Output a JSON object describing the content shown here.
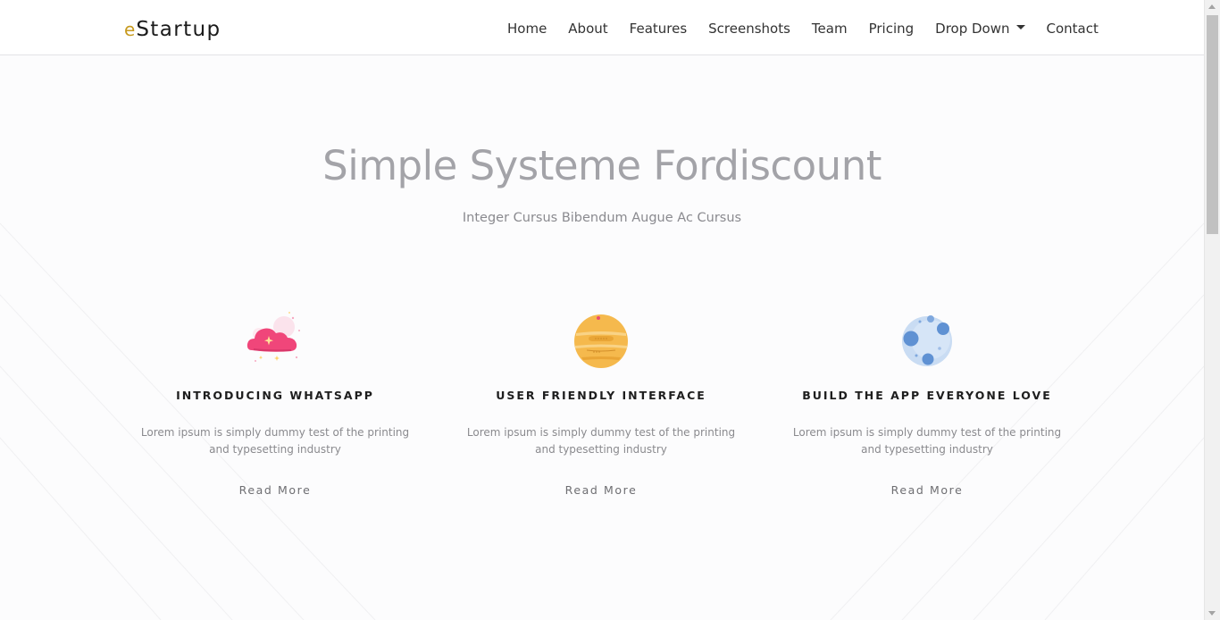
{
  "navbar": {
    "brand_prefix": "e",
    "brand_rest": "Startup",
    "items": [
      {
        "label": "Home"
      },
      {
        "label": "About"
      },
      {
        "label": "Features"
      },
      {
        "label": "Screenshots"
      },
      {
        "label": "Team"
      },
      {
        "label": "Pricing"
      },
      {
        "label": "Drop Down"
      },
      {
        "label": "Contact"
      }
    ]
  },
  "hero": {
    "title": "Simple Systeme Fordiscount",
    "subtitle": "Integer Cursus Bibendum Augue Ac Cursus"
  },
  "features": [
    {
      "icon": "pink-cloud-icon",
      "title": "INTRODUCING WHATSAPP",
      "text": "Lorem ipsum is simply dummy test of the printing and typesetting industry",
      "link": "Read More"
    },
    {
      "icon": "orange-planet-icon",
      "title": "USER FRIENDLY INTERFACE",
      "text": "Lorem ipsum is simply dummy test of the printing and typesetting industry",
      "link": "Read More"
    },
    {
      "icon": "blue-moon-icon",
      "title": "BUILD THE APP EVERYONE LOVE",
      "text": "Lorem ipsum is simply dummy test of the printing and typesetting industry",
      "link": "Read More"
    }
  ],
  "colors": {
    "brand_accent": "#c79a1e",
    "cloud": "#f0467a",
    "planet": "#f5b94d",
    "moon": "#5f91d3"
  }
}
